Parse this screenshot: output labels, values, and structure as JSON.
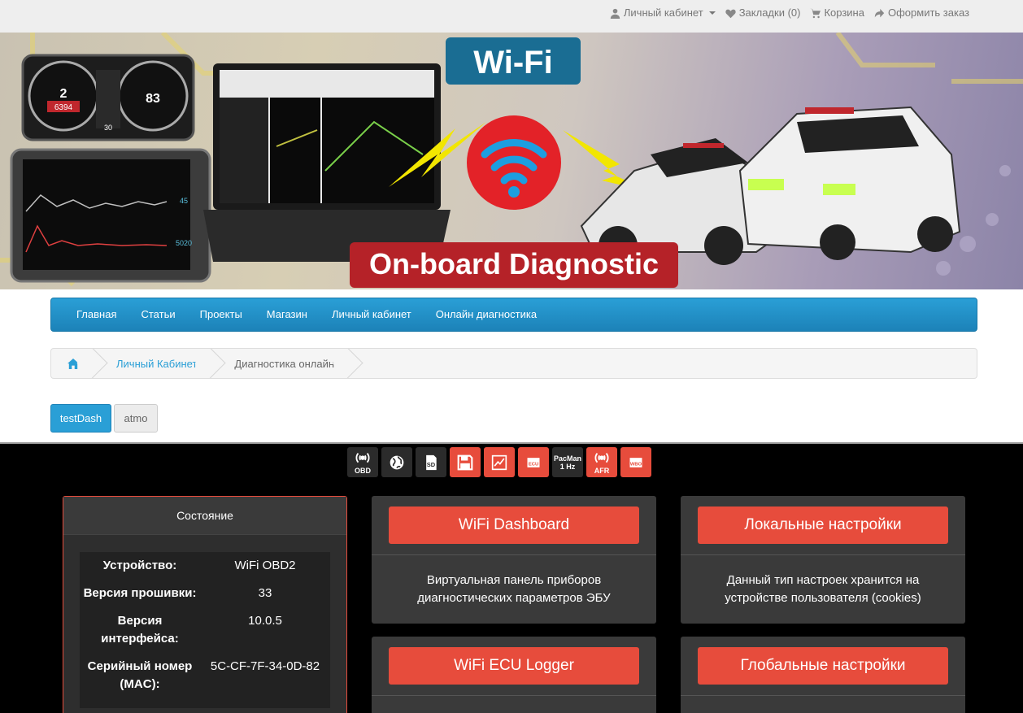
{
  "topbar": {
    "account": "Личный кабинет",
    "wishlist": "Закладки (0)",
    "cart": "Корзина",
    "checkout": "Оформить заказ"
  },
  "banner": {
    "wifi_label": "Wi-Fi",
    "obd_label": "On-board Diagnostic",
    "gauge_left": "2",
    "gauge_left_sub": "6394",
    "gauge_right": "83",
    "gauge_bottom": "30",
    "tablet_value_1": "45",
    "tablet_value_2": "5020"
  },
  "nav": {
    "items": [
      "Главная",
      "Статьи",
      "Проекты",
      "Магазин",
      "Личный кабинет",
      "Онлайн диагностика"
    ]
  },
  "breadcrumb": {
    "account": "Личный Кабинет",
    "current": "Диагностика онлайн"
  },
  "tabs": {
    "active": "testDash",
    "other": "atmo"
  },
  "icons": {
    "obd": "OBD",
    "sd": "SD",
    "ecu": "ECU",
    "pacman_1": "PacMan",
    "pacman_2": "1 Hz",
    "afr": "AFR",
    "wbo": "WBO"
  },
  "state": {
    "title": "Состояние",
    "rows": [
      {
        "k": "Устройство:",
        "v": "WiFi OBD2"
      },
      {
        "k": "Версия прошивки:",
        "v": "33"
      },
      {
        "k": "Версия интерфейса:",
        "v": "10.0.5"
      },
      {
        "k": "Серийный номер (MAC):",
        "v": "5C-CF-7F-34-0D-82"
      }
    ]
  },
  "cards": {
    "dashboard": {
      "title": "WiFi Dashboard",
      "desc": "Виртуальная панель приборов диагностических параметров ЭБУ"
    },
    "local": {
      "title": "Локальные настройки",
      "desc": "Данный тип настроек хранится на устройстве пользователя (cookies)"
    },
    "logger": {
      "title": "WiFi ECU Logger"
    },
    "global": {
      "title": "Глобальные настройки"
    }
  },
  "colors": {
    "accent_blue": "#2a9fd6",
    "accent_red": "#e74c3c",
    "dark_panel": "#3a3a3a"
  }
}
